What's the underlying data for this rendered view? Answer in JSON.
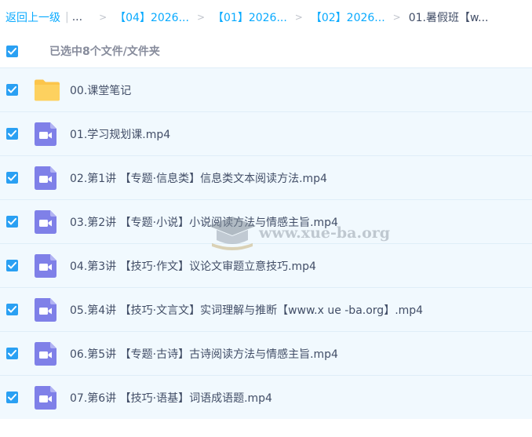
{
  "breadcrumb": {
    "back_label": "返回上一级",
    "ellipsis": "...",
    "separator": ">",
    "crumbs": [
      "【04】2026...",
      "【01】2026...",
      "【02】2026..."
    ],
    "current": "01.暑假班【w..."
  },
  "selection": {
    "text": "已选中8个文件/文件夹",
    "checked": true
  },
  "files": [
    {
      "name": "00.课堂笔记",
      "type": "folder",
      "checked": true
    },
    {
      "name": "01.学习规划课.mp4",
      "type": "video",
      "checked": true
    },
    {
      "name": "02.第1讲 【专题·信息类】信息类文本阅读方法.mp4",
      "type": "video",
      "checked": true
    },
    {
      "name": "03.第2讲 【专题·小说】小说阅读方法与情感主旨.mp4",
      "type": "video",
      "checked": true
    },
    {
      "name": "04.第3讲 【技巧·作文】议论文审题立意技巧.mp4",
      "type": "video",
      "checked": true
    },
    {
      "name": "05.第4讲 【技巧·文言文】实词理解与推断【www.x ue -ba.org】.mp4",
      "type": "video",
      "checked": true
    },
    {
      "name": "06.第5讲 【专题·古诗】古诗阅读方法与情感主旨.mp4",
      "type": "video",
      "checked": true
    },
    {
      "name": "07.第6讲 【技巧·语基】词语成语题.mp4",
      "type": "video",
      "checked": true
    }
  ],
  "watermark": {
    "text": "www.xue-ba.org"
  },
  "colors": {
    "accent": "#09aaff",
    "checkbox": "#2aa0f3",
    "row_background": "#f1f9fe",
    "folder": "#fcc54b",
    "video": "#7f80e8"
  },
  "icons": {
    "checkbox": "check-icon",
    "folder": "folder-icon",
    "video": "video-file-icon"
  }
}
